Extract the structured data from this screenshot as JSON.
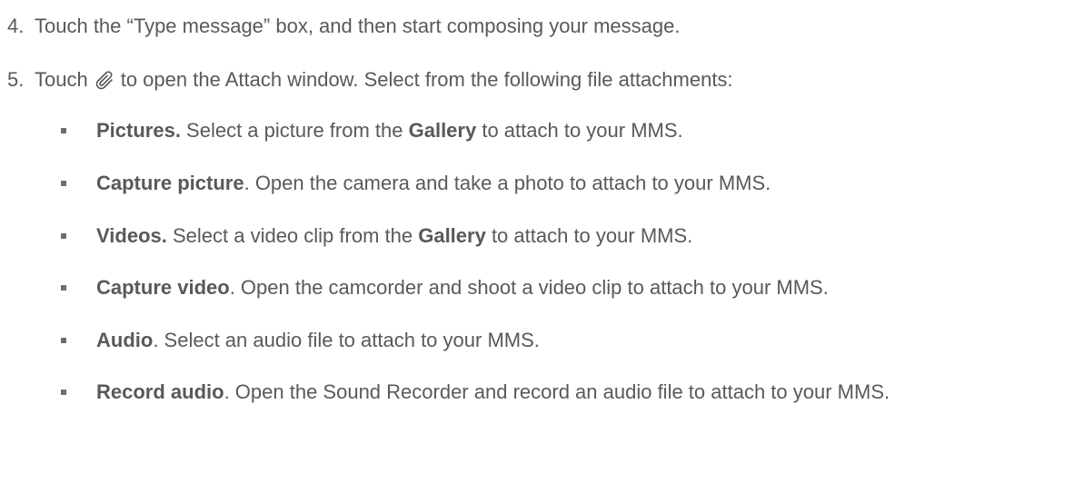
{
  "step4": {
    "number": "4.",
    "text": "Touch the “Type message” box, and then start composing your message."
  },
  "step5": {
    "number": "5.",
    "text_before": "Touch",
    "icon": "paperclip-icon",
    "text_after": "to open the Attach window. Select from the following file attachments:"
  },
  "items": [
    {
      "term": "Pictures.",
      "text1": " Select a picture from the ",
      "term2": "Gallery",
      "text2": " to attach to your MMS."
    },
    {
      "term": "Capture picture",
      "text1": ". Open the camera and take a photo to attach to your MMS."
    },
    {
      "term": "Videos.",
      "text1": " Select a video clip from the ",
      "term2": "Gallery",
      "text2": " to attach to your MMS."
    },
    {
      "term": "Capture video",
      "text1": ". Open the camcorder and shoot a video clip to attach to your MMS."
    },
    {
      "term": "Audio",
      "text1": ". Select an audio file to attach to your MMS."
    },
    {
      "term": "Record audio",
      "text1": ". Open the Sound Recorder and record an audio file to attach to your MMS."
    }
  ]
}
